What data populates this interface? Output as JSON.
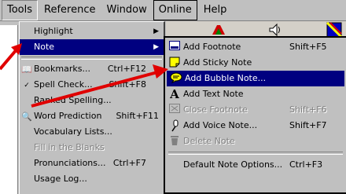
{
  "menubar": {
    "items": [
      {
        "label": "Tools",
        "state": "active"
      },
      {
        "label": "Reference",
        "state": "normal"
      },
      {
        "label": "Window",
        "state": "normal"
      },
      {
        "label": "Online",
        "state": "boxed"
      },
      {
        "label": "Help",
        "state": "normal"
      }
    ]
  },
  "tools_menu": {
    "items": [
      {
        "label": "Highlight",
        "shortcut": "",
        "has_submenu": true,
        "icon": ""
      },
      {
        "label": "Note",
        "shortcut": "",
        "has_submenu": true,
        "icon": "",
        "selected": true
      },
      {
        "label": "Bookmarks...",
        "shortcut": "Ctrl+F12",
        "icon": "bookmark-icon"
      },
      {
        "label": "Spell Check...",
        "shortcut": "Shift+F8",
        "icon": "spell-check-icon"
      },
      {
        "label": "Ranked Spelling...",
        "shortcut": ""
      },
      {
        "label": "Word Prediction",
        "shortcut": "Shift+F11",
        "icon": "magnifier-icon"
      },
      {
        "label": "Vocabulary Lists...",
        "shortcut": ""
      },
      {
        "label": "Fill in the Blanks",
        "shortcut": "",
        "disabled": true
      },
      {
        "label": "Pronunciations...",
        "shortcut": "Ctrl+F7"
      },
      {
        "label": "Usage Log...",
        "shortcut": ""
      }
    ]
  },
  "note_menu": {
    "items": [
      {
        "label": "Add Footnote",
        "shortcut": "Shift+F5",
        "icon": "footnote-icon"
      },
      {
        "label": "Add Sticky Note",
        "shortcut": "",
        "icon": "sticky-note-icon"
      },
      {
        "label": "Add Bubble Note...",
        "shortcut": "",
        "icon": "bubble-note-icon",
        "selected": true
      },
      {
        "label": "Add Text Note",
        "shortcut": "",
        "icon": "text-note-icon"
      },
      {
        "label": "Close Footnote",
        "shortcut": "Shift+F6",
        "icon": "close-footnote-icon",
        "disabled": true
      },
      {
        "label": "Add Voice Note...",
        "shortcut": "Shift+F7",
        "icon": "voice-note-icon"
      },
      {
        "label": "Delete Note",
        "shortcut": "",
        "icon": "trash-icon",
        "disabled": true
      },
      {
        "label": "Default Note Options...",
        "shortcut": "Ctrl+F3"
      }
    ]
  },
  "colors": {
    "selection": "#000080",
    "arrow": "#e00000",
    "menu_bg": "#c0c0c0"
  }
}
